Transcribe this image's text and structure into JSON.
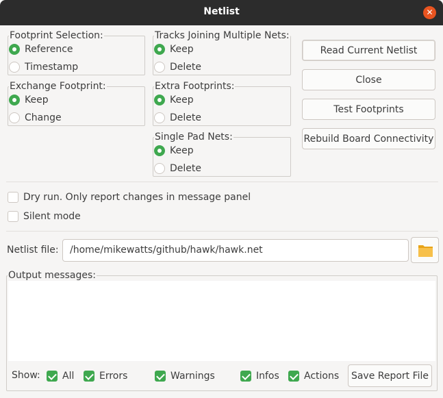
{
  "window": {
    "title": "Netlist",
    "close_icon": "close-icon",
    "close_color": "#e95420"
  },
  "accent_color": "#3fa84f",
  "footprint_selection": {
    "label": "Footprint Selection:",
    "options": [
      "Reference",
      "Timestamp"
    ],
    "selected": "Reference"
  },
  "exchange_footprint": {
    "label": "Exchange Footprint:",
    "options": [
      "Keep",
      "Change"
    ],
    "selected": "Keep"
  },
  "tracks_joining": {
    "label": "Tracks Joining Multiple Nets:",
    "options": [
      "Keep",
      "Delete"
    ],
    "selected": "Keep"
  },
  "extra_footprints": {
    "label": "Extra Footprints:",
    "options": [
      "Keep",
      "Delete"
    ],
    "selected": "Keep"
  },
  "single_pad_nets": {
    "label": "Single Pad Nets:",
    "options": [
      "Keep",
      "Delete"
    ],
    "selected": "Keep"
  },
  "buttons": {
    "read_netlist": "Read Current Netlist",
    "close": "Close",
    "test_footprints": "Test Footprints",
    "rebuild": "Rebuild Board Connectivity"
  },
  "options": {
    "dry_run": {
      "label": "Dry run. Only report changes in message panel",
      "checked": false
    },
    "silent_mode": {
      "label": "Silent mode",
      "checked": false
    }
  },
  "netlist_file": {
    "label": "Netlist file:",
    "value": "/home/mikewatts/github/hawk/hawk.net",
    "browse_icon": "folder-icon"
  },
  "output": {
    "label": "Output messages:",
    "show_label": "Show:",
    "filters": [
      {
        "label": "All",
        "checked": true
      },
      {
        "label": "Errors",
        "checked": true
      },
      {
        "label": "Warnings",
        "checked": true
      },
      {
        "label": "Infos",
        "checked": true
      },
      {
        "label": "Actions",
        "checked": true
      }
    ],
    "save_button": "Save Report File"
  }
}
